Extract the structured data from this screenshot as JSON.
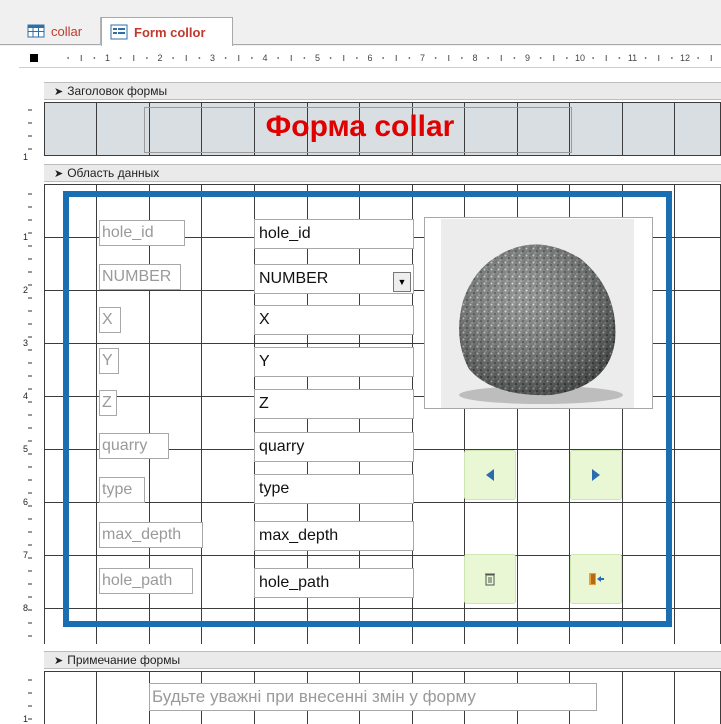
{
  "tabs": [
    {
      "label": "collar",
      "icon": "table-icon"
    },
    {
      "label": "Form collor",
      "icon": "form-icon"
    }
  ],
  "ruler": {
    "h_marks": [
      "1",
      "2",
      "3",
      "4",
      "5",
      "6",
      "7",
      "8",
      "9",
      "10",
      "11",
      "12"
    ],
    "v_marks_header": [
      "1"
    ],
    "v_marks_detail": [
      "1",
      "2",
      "3",
      "4",
      "5",
      "6",
      "7",
      "8"
    ],
    "v_marks_footer": [
      "1"
    ]
  },
  "sections": {
    "header": "Заголовок формы",
    "detail": "Область данных",
    "footer": "Примечание формы"
  },
  "form": {
    "title": "Форма collar",
    "fields": [
      {
        "label": "hole_id",
        "value": "hole_id"
      },
      {
        "label": "NUMBER",
        "value": "NUMBER"
      },
      {
        "label": "X",
        "value": "X"
      },
      {
        "label": "Y",
        "value": "Y"
      },
      {
        "label": "Z",
        "value": "Z"
      },
      {
        "label": "quarry",
        "value": "quarry"
      },
      {
        "label": "type",
        "value": "type"
      },
      {
        "label": "max_depth",
        "value": "max_depth"
      },
      {
        "label": "hole_path",
        "value": "hole_path"
      }
    ],
    "image": "rock-image",
    "buttons": [
      "previous-record-icon",
      "next-record-icon",
      "delete-record-icon",
      "exit-icon"
    ],
    "note": "Будьте уважні при внесенні змін у форму"
  },
  "colors": {
    "frame": "#1a6fb3",
    "title": "#e00000",
    "nav_button": "#e9f7d4"
  }
}
